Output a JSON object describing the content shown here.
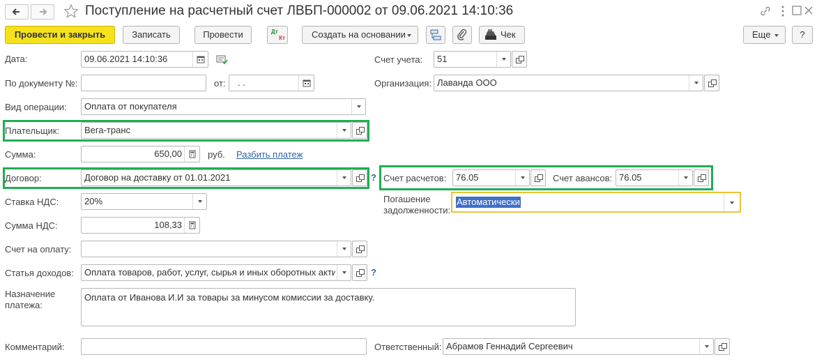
{
  "window": {
    "title": "Поступление на расчетный счет ЛВБП-000002 от 09.06.2021 14:10:36"
  },
  "toolbar": {
    "post_and_close": "Провести и закрыть",
    "save": "Записать",
    "post": "Провести",
    "dt_kt_top": "Дт",
    "dt_kt_bottom": "Кт",
    "create_based_on": "Создать на основании",
    "receipt": "Чек",
    "more": "Еще",
    "help": "?"
  },
  "form": {
    "date": {
      "label": "Дата:",
      "value": "09.06.2021 14:10:36"
    },
    "doc_number": {
      "label": "По документу №:",
      "value": ""
    },
    "doc_date": {
      "label": "от:",
      "value": " .  ."
    },
    "operation_type": {
      "label": "Вид операции:",
      "value": "Оплата от покупателя"
    },
    "payer": {
      "label": "Плательщик:",
      "value": "Вега-транс"
    },
    "amount": {
      "label": "Сумма:",
      "value": "650,00",
      "currency": "руб.",
      "split_link": "Разбить платеж"
    },
    "contract": {
      "label": "Договор:",
      "value": "Договор на доставку от 01.01.2021",
      "help": "?"
    },
    "vat_rate": {
      "label": "Ставка НДС:",
      "value": "20%"
    },
    "vat_amount": {
      "label": "Сумма НДС:",
      "value": "108,33"
    },
    "invoice": {
      "label": "Счет на оплату:",
      "value": ""
    },
    "income_item": {
      "label": "Статья доходов:",
      "value": "Оплата товаров, работ, услуг, сырья и иных оборотных акти",
      "help": "?"
    },
    "purpose": {
      "label_line1": "Назначение",
      "label_line2": "платежа:",
      "value": "Оплата от Иванова И.И за товары за минусом комиссии за доставку."
    },
    "comment": {
      "label": "Комментарий:",
      "value": ""
    },
    "account": {
      "label": "Счет учета:",
      "value": "51"
    },
    "organization": {
      "label": "Организация:",
      "value": "Лаванда ООО"
    },
    "settlement_account": {
      "label": "Счет расчетов:",
      "value": "76.05"
    },
    "advance_account": {
      "label": "Счет авансов:",
      "value": "76.05"
    },
    "debt_repayment": {
      "label_line1": "Погашение",
      "label_line2": "задолженности:",
      "value": "Автоматически"
    },
    "responsible": {
      "label": "Ответственный:",
      "value": "Абрамов Геннадий Сергеевич"
    }
  },
  "icons": {
    "back": "back-arrow-icon",
    "forward": "forward-arrow-icon",
    "favorite": "star-icon",
    "link": "link-icon",
    "menu": "kebab-menu-icon",
    "maximize": "maximize-icon",
    "close": "close-icon"
  }
}
